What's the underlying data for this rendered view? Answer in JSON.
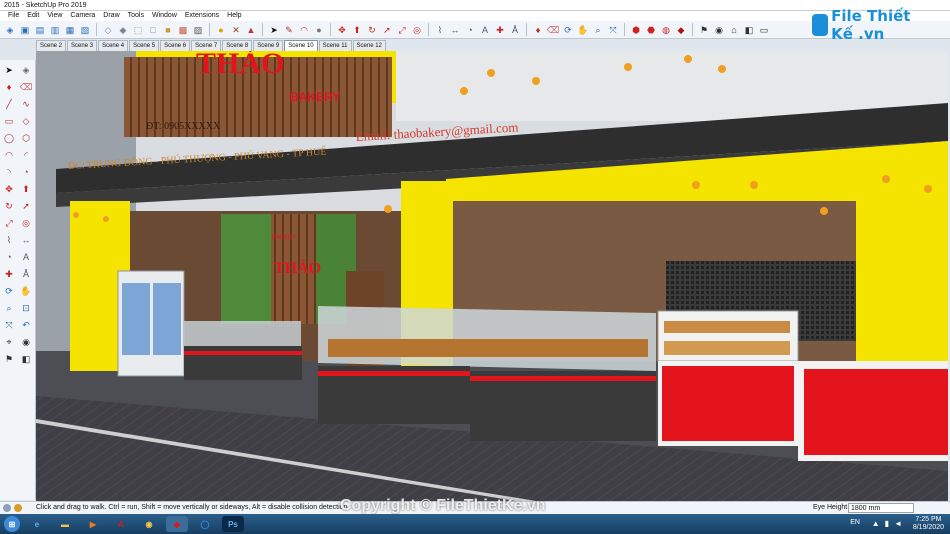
{
  "window": {
    "title": "2015 - SketchUp Pro 2019"
  },
  "menu": [
    "File",
    "Edit",
    "View",
    "Camera",
    "Draw",
    "Tools",
    "Window",
    "Extensions",
    "Help"
  ],
  "scenes": [
    "Scene 2",
    "Scene 3",
    "Scene 4",
    "Scene 5",
    "Scene 6",
    "Scene 7",
    "Scene 8",
    "Scene 9",
    "Scene 10",
    "Scene 11",
    "Scene 12"
  ],
  "active_scene": "Scene 10",
  "model": {
    "brand": "THẢO",
    "brand_sub": "BAKERY",
    "phone": "ĐT: 0905XXXXX",
    "email": "Email: thaobakery@gmail.com",
    "address": "ĐC: TRUNG ĐÔNG - PHÚ THƯỢNG - PHÚ VANG - TP HUẾ",
    "inner_sign_top": "BAKERY",
    "inner_sign": "THẢO"
  },
  "status": {
    "hint": "Click and drag to walk.  Ctrl = run, Shift = move vertically or sideways, Alt = disable collision detection",
    "eye_label": "Eye Height",
    "eye_value": "1800 mm"
  },
  "taskbar": {
    "lang": "EN",
    "time": "7:25 PM",
    "date": "8/19/2020"
  },
  "logo": {
    "text": "File Thiết Kế .vn"
  },
  "watermark": "Copyright © FileThietKe.vn",
  "colors": {
    "yellow": "#f5e400",
    "red": "#e3141c",
    "dark": "#2e2e2e",
    "wood": "#7a4a2c",
    "road": "#3f3f45"
  }
}
